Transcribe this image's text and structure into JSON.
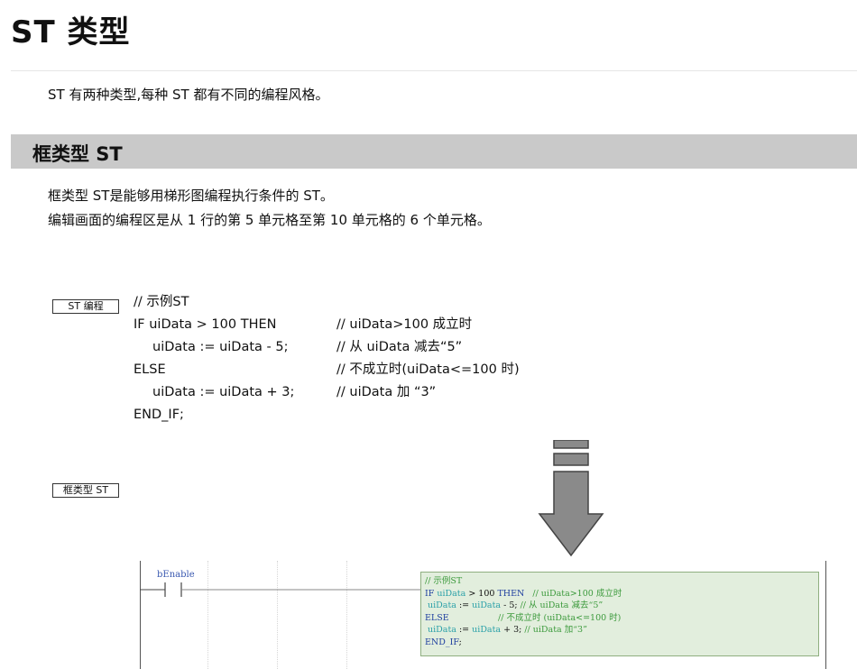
{
  "page": {
    "title": "ST 类型",
    "intro": "ST 有两种类型,每种 ST 都有不同的编程风格。"
  },
  "section": {
    "title": "框类型 ST",
    "desc1": "框类型 ST是能够用梯形图编程执行条件的 ST。",
    "desc2": "编辑画面的编程区是从 1 行的第 5 单元格至第 10 单元格的 6 个单元格。"
  },
  "tags": {
    "st_program": "ST 编程",
    "box_type_st": "框类型 ST"
  },
  "code_example": {
    "lines": [
      {
        "stmt": "// 示例ST",
        "comment": "",
        "indent": false
      },
      {
        "stmt": "IF uiData > 100 THEN",
        "comment": "// uiData>100 成立时",
        "indent": false
      },
      {
        "stmt": "uiData := uiData - 5;",
        "comment": "// 从 uiData 减去“5”",
        "indent": true
      },
      {
        "stmt": "ELSE",
        "comment": "// 不成立时(uiData<=100 时)",
        "indent": false
      },
      {
        "stmt": "uiData := uiData + 3;",
        "comment": "// uiData 加 “3”",
        "indent": true
      },
      {
        "stmt": "END_IF;",
        "comment": "",
        "indent": false
      }
    ]
  },
  "ladder": {
    "contact_label": "bEnable",
    "box_colors": {
      "background": "#e2eedd",
      "border": "#8faf80",
      "keyword": "#1f3f9f",
      "variable": "#2aa0a8",
      "comment": "#3c9a3c"
    },
    "box_lines": [
      {
        "tokens": [
          {
            "t": "// 示例ST",
            "c": "cm"
          }
        ]
      },
      {
        "tokens": [
          {
            "t": "IF ",
            "c": "kw"
          },
          {
            "t": "uiData",
            "c": "var"
          },
          {
            "t": " > 100 ",
            "c": "pl"
          },
          {
            "t": "THEN",
            "c": "kw"
          },
          {
            "t": "   // uiData>100 成立时",
            "c": "cm"
          }
        ]
      },
      {
        "tokens": [
          {
            "t": " uiData",
            "c": "var"
          },
          {
            "t": " := ",
            "c": "pl"
          },
          {
            "t": "uiData",
            "c": "var"
          },
          {
            "t": " - 5; ",
            "c": "pl"
          },
          {
            "t": "// 从 uiData 减去“5”",
            "c": "cm"
          }
        ]
      },
      {
        "tokens": [
          {
            "t": "ELSE",
            "c": "kw"
          },
          {
            "t": "                  // 不成立时 (uiData<=100 时)",
            "c": "cm"
          }
        ]
      },
      {
        "tokens": [
          {
            "t": " uiData",
            "c": "var"
          },
          {
            "t": " := ",
            "c": "pl"
          },
          {
            "t": "uiData",
            "c": "var"
          },
          {
            "t": " + 3; ",
            "c": "pl"
          },
          {
            "t": "// uiData 加“3”",
            "c": "cm"
          }
        ]
      },
      {
        "tokens": [
          {
            "t": "END_IF",
            "c": "kw"
          },
          {
            "t": ";",
            "c": "pl"
          }
        ]
      }
    ]
  }
}
